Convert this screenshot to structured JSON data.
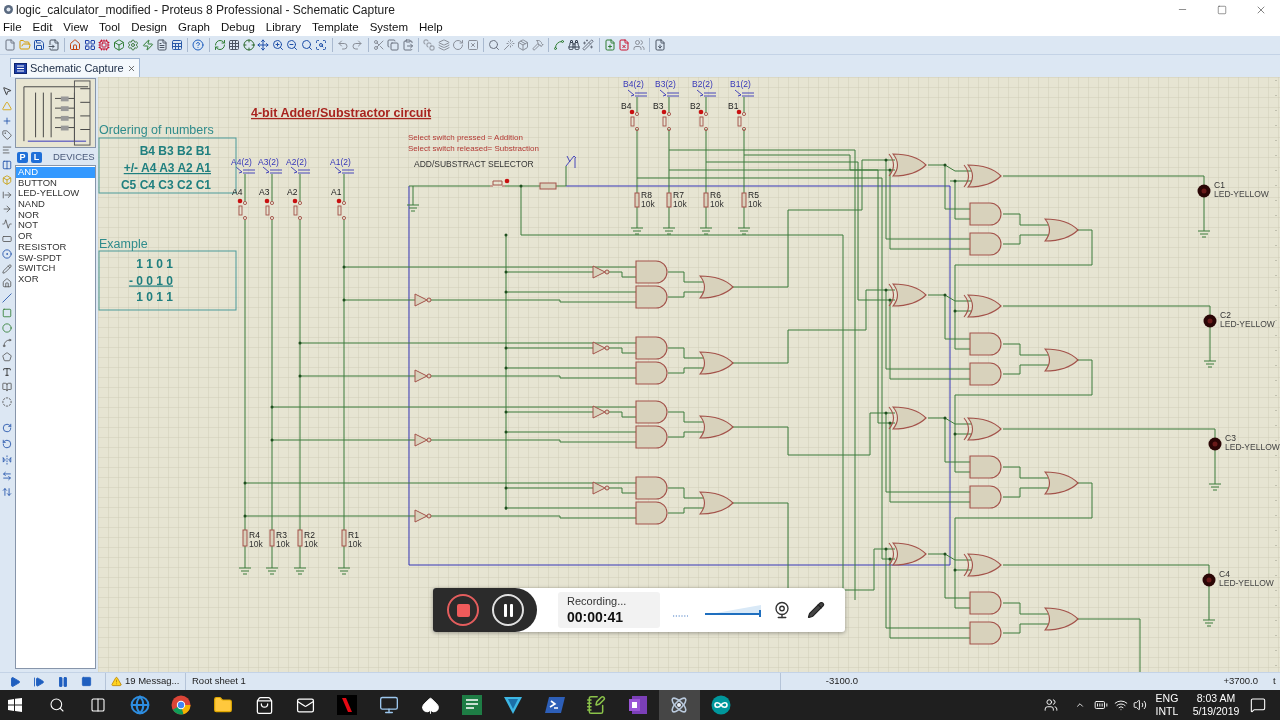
{
  "window": {
    "title": "logic_calculator_modified - Proteus 8 Professional - Schematic Capture"
  },
  "menu": [
    "File",
    "Edit",
    "View",
    "Tool",
    "Design",
    "Graph",
    "Debug",
    "Library",
    "Template",
    "System",
    "Help"
  ],
  "tabs": [
    {
      "label": "Schematic Capture",
      "selected": true
    }
  ],
  "device_panel": {
    "buttons": [
      "P",
      "L"
    ],
    "title": "DEVICES",
    "devices": [
      {
        "label": "AND",
        "selected": true
      },
      {
        "label": "BUTTON",
        "selected": false
      },
      {
        "label": "LED-YELLOW",
        "selected": false
      },
      {
        "label": "NAND",
        "selected": false
      },
      {
        "label": "NOR",
        "selected": false
      },
      {
        "label": "NOT",
        "selected": false
      },
      {
        "label": "OR",
        "selected": false
      },
      {
        "label": "RESISTOR",
        "selected": false
      },
      {
        "label": "SW-SPDT",
        "selected": false
      },
      {
        "label": "SWITCH",
        "selected": false
      },
      {
        "label": "XOR",
        "selected": false
      }
    ]
  },
  "schematic": {
    "title": "4-bit Adder/Substractor circuit",
    "notes": [
      "Select switch pressed = Addition",
      "Select switch released= Substraction"
    ],
    "selector_label": "ADD/SUBSTRACT SELECTOR",
    "ordering": {
      "heading": "Ordering of numbers",
      "lines": [
        {
          "text": "B4 B3 B2 B1",
          "underlined": false
        },
        {
          "text": "+/- A4 A3 A2 A1",
          "underlined": true
        },
        {
          "text": "C5 C4 C3 C2 C1",
          "underlined": false
        }
      ]
    },
    "example": {
      "heading": "Example",
      "lines": [
        {
          "text": "1 1 0 1",
          "underlined": false
        },
        {
          "text": "- 0 0 1 0",
          "underlined": true
        },
        {
          "text": "1 0 1 1",
          "underlined": false
        }
      ]
    },
    "a_switches": [
      {
        "name": "A4",
        "terminal": "A4(2)"
      },
      {
        "name": "A3",
        "terminal": "A3(2)"
      },
      {
        "name": "A2",
        "terminal": "A2(2)"
      },
      {
        "name": "A1",
        "terminal": "A1(2)"
      }
    ],
    "a_resistors": [
      {
        "name": "R4",
        "value": "10k"
      },
      {
        "name": "R3",
        "value": "10k"
      },
      {
        "name": "R2",
        "value": "10k"
      },
      {
        "name": "R1",
        "value": "10k"
      }
    ],
    "b_switches": [
      {
        "name": "B4",
        "terminal": "B4(2)"
      },
      {
        "name": "B3",
        "terminal": "B3(2)"
      },
      {
        "name": "B2",
        "terminal": "B2(2)"
      },
      {
        "name": "B1",
        "terminal": "B1(2)"
      }
    ],
    "b_resistors": [
      {
        "name": "R8",
        "value": "10k"
      },
      {
        "name": "R7",
        "value": "10k"
      },
      {
        "name": "R6",
        "value": "10k"
      },
      {
        "name": "R5",
        "value": "10k"
      }
    ],
    "leds": [
      {
        "name": "C1",
        "value": "LED-YELLOW"
      },
      {
        "name": "C2",
        "value": "LED-YELLOW"
      },
      {
        "name": "C3",
        "value": "LED-YELLOW"
      },
      {
        "name": "C4",
        "value": "LED-YELLOW"
      }
    ]
  },
  "recorder": {
    "status": "Recording...",
    "elapsed": "00:00:41",
    "volume": {
      "level": 1
    }
  },
  "status_bar": {
    "messages": "19 Messag...",
    "sheet": "Root sheet 1",
    "x_coordinate": "-3100.0",
    "y_coordinate": "+3700.0",
    "units": "t"
  },
  "taskbar": {
    "apps": [
      {
        "selected": false
      },
      {
        "selected": false
      },
      {
        "selected": false
      },
      {
        "selected": false
      },
      {
        "selected": false
      },
      {
        "selected": false
      },
      {
        "selected": false
      },
      {
        "selected": false
      },
      {
        "selected": false
      },
      {
        "selected": false
      },
      {
        "selected": false
      },
      {
        "selected": false
      },
      {
        "selected": false
      },
      {
        "selected": false
      },
      {
        "selected": false
      },
      {
        "selected": true
      },
      {
        "selected": false
      }
    ],
    "language": [
      "ENG",
      "INTL"
    ],
    "time": "8:03 AM",
    "date": "5/19/2019"
  }
}
